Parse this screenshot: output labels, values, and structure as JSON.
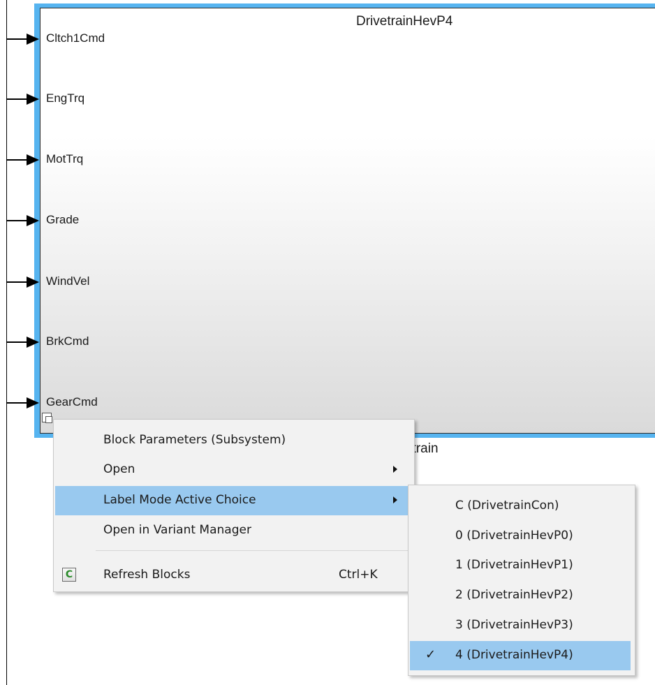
{
  "block": {
    "title": "DrivetrainHevP4",
    "name_visible": "etrain"
  },
  "ports": [
    {
      "label": "Cltch1Cmd"
    },
    {
      "label": "EngTrq"
    },
    {
      "label": "MotTrq"
    },
    {
      "label": "Grade"
    },
    {
      "label": "WindVel"
    },
    {
      "label": "BrkCmd"
    },
    {
      "label": "GearCmd"
    }
  ],
  "context_menu": {
    "items": [
      {
        "label": "Block Parameters (Subsystem)"
      },
      {
        "label": "Open"
      },
      {
        "label": "Label Mode Active Choice"
      },
      {
        "label": "Open in Variant Manager"
      },
      {
        "label": "Refresh Blocks",
        "shortcut": "Ctrl+K"
      }
    ]
  },
  "submenu": {
    "items": [
      {
        "label": "C (DrivetrainCon)"
      },
      {
        "label": "0 (DrivetrainHevP0)"
      },
      {
        "label": "1 (DrivetrainHevP1)"
      },
      {
        "label": "2 (DrivetrainHevP2)"
      },
      {
        "label": "3 (DrivetrainHevP3)"
      },
      {
        "label": "4 (DrivetrainHevP4)",
        "checked": true,
        "check_glyph": "✓"
      }
    ]
  },
  "colors": {
    "selection": "#99c9ef",
    "block_highlight": "#56b4f0"
  }
}
